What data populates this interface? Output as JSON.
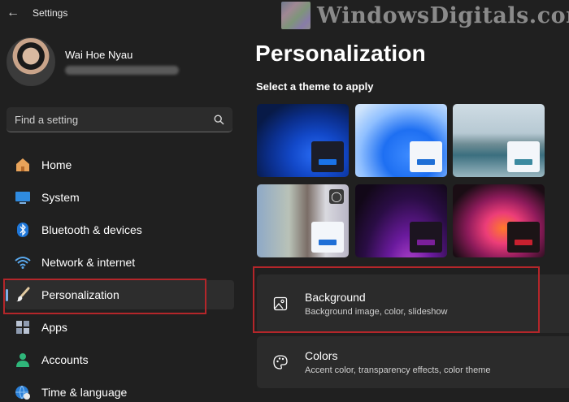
{
  "window": {
    "title": "Settings",
    "back_icon": "back-arrow-icon"
  },
  "watermark": {
    "text": "WindowsDigitals.com"
  },
  "profile": {
    "name": "Wai Hoe Nyau"
  },
  "search": {
    "placeholder": "Find a setting",
    "icon": "search-icon"
  },
  "sidebar": {
    "items": [
      {
        "label": "Home",
        "icon": "home-icon",
        "active": false
      },
      {
        "label": "System",
        "icon": "display-icon",
        "active": false
      },
      {
        "label": "Bluetooth & devices",
        "icon": "bluetooth-icon",
        "active": false
      },
      {
        "label": "Network & internet",
        "icon": "wifi-icon",
        "active": false
      },
      {
        "label": "Personalization",
        "icon": "paintbrush-icon",
        "active": true
      },
      {
        "label": "Apps",
        "icon": "apps-icon",
        "active": false
      },
      {
        "label": "Accounts",
        "icon": "accounts-icon",
        "active": false
      },
      {
        "label": "Time & language",
        "icon": "globe-clock-icon",
        "active": false
      }
    ]
  },
  "main": {
    "title": "Personalization",
    "theme_heading": "Select a theme to apply",
    "themes": [
      {
        "accent": "#1a73e8"
      },
      {
        "accent": "#1f6fd6"
      },
      {
        "accent": "#3c8aa0"
      },
      {
        "accent": "#1f6fd6"
      },
      {
        "accent": "#7a1f9a"
      },
      {
        "accent": "#c8202f"
      }
    ],
    "cards": [
      {
        "title": "Background",
        "subtitle": "Background image, color, slideshow",
        "icon": "image-icon"
      },
      {
        "title": "Colors",
        "subtitle": "Accent color, transparency effects, color theme",
        "icon": "palette-icon"
      }
    ]
  },
  "colors": {
    "window_bg": "#202020",
    "card_bg": "#2b2b2b",
    "accent": "#7fb0e8",
    "highlight": "#b4262a"
  }
}
